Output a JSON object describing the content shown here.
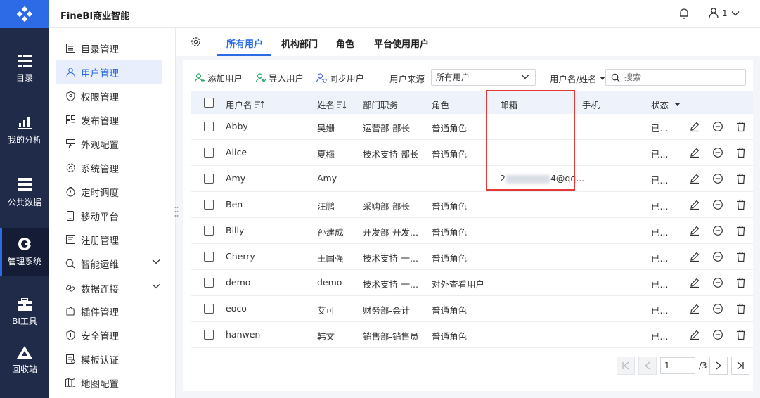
{
  "app": {
    "title": "FineBI商业智能"
  },
  "header": {
    "user_label": "1"
  },
  "rail": {
    "items": [
      {
        "label": "目录"
      },
      {
        "label": "我的分析"
      },
      {
        "label": "公共数据"
      },
      {
        "label": "管理系统",
        "active": true
      },
      {
        "label": "BI工具"
      },
      {
        "label": "回收站"
      }
    ]
  },
  "sidebar": {
    "items": [
      {
        "label": "目录管理"
      },
      {
        "label": "用户管理",
        "active": true
      },
      {
        "label": "权限管理"
      },
      {
        "label": "发布管理"
      },
      {
        "label": "外观配置"
      },
      {
        "label": "系统管理"
      },
      {
        "label": "定时调度"
      },
      {
        "label": "移动平台"
      },
      {
        "label": "注册管理"
      },
      {
        "label": "智能运维"
      },
      {
        "label": "数据连接"
      },
      {
        "label": "插件管理"
      },
      {
        "label": "安全管理"
      },
      {
        "label": "模板认证"
      },
      {
        "label": "地图配置"
      }
    ]
  },
  "tabs": [
    {
      "label": "所有用户",
      "active": true
    },
    {
      "label": "机构部门"
    },
    {
      "label": "角色"
    },
    {
      "label": "平台使用用户"
    }
  ],
  "toolbar": {
    "add_user": "添加用户",
    "import_user": "导入用户",
    "sync_user": "同步用户",
    "source_label": "用户来源",
    "source_value": "所有用户",
    "filter_label": "用户名/姓名",
    "search_placeholder": "搜索"
  },
  "table": {
    "columns": [
      "用户名",
      "姓名",
      "部门职务",
      "角色",
      "邮箱",
      "手机",
      "状态"
    ],
    "rows": [
      {
        "username": "Abby",
        "name": "吴姗",
        "dept": "运营部-部长",
        "role": "普通角色",
        "email": "",
        "phone": "",
        "status": "已..."
      },
      {
        "username": "Alice",
        "name": "夏梅",
        "dept": "技术支持-部长",
        "role": "普通角色",
        "email": "",
        "phone": "",
        "status": "已..."
      },
      {
        "username": "Amy",
        "name": "Amy",
        "dept": "",
        "role": "",
        "email_prefix": "2",
        "email_suffix": "4@qq...",
        "phone": "",
        "status": "已..."
      },
      {
        "username": "Ben",
        "name": "汪鹏",
        "dept": "采购部-部长",
        "role": "普通角色",
        "email": "",
        "phone": "",
        "status": "已..."
      },
      {
        "username": "Billy",
        "name": "孙建成",
        "dept": "开发部-开发...",
        "role": "普通角色",
        "email": "",
        "phone": "",
        "status": "已..."
      },
      {
        "username": "Cherry",
        "name": "王国强",
        "dept": "技术支持-一...",
        "role": "普通角色",
        "email": "",
        "phone": "",
        "status": "已..."
      },
      {
        "username": "demo",
        "name": "demo",
        "dept": "技术支持-一...",
        "role": "对外查看用户",
        "email": "",
        "phone": "",
        "status": "已..."
      },
      {
        "username": "eoco",
        "name": "艾可",
        "dept": "财务部-会计",
        "role": "普通角色",
        "email": "",
        "phone": "",
        "status": "已..."
      },
      {
        "username": "hanwen",
        "name": "韩文",
        "dept": "销售部-销售员",
        "role": "普通角色",
        "email": "",
        "phone": "",
        "status": "已..."
      }
    ]
  },
  "pagination": {
    "current": "1",
    "total": "/3"
  },
  "colors": {
    "accent": "#2d6be6",
    "rail": "#202b4a",
    "highlight": "#e53935"
  }
}
